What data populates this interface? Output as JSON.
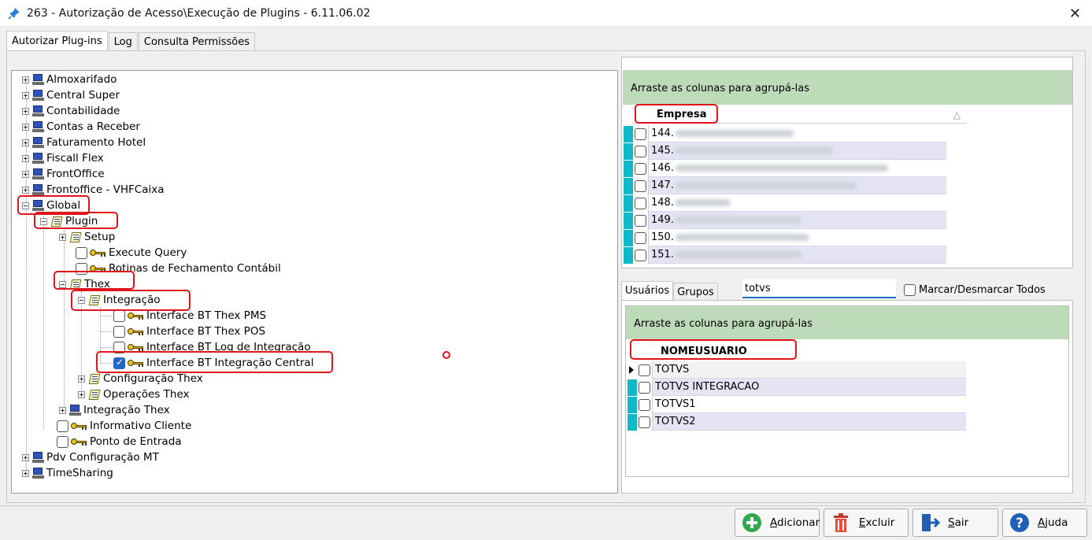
{
  "window": {
    "title": "263 - Autorização de Acesso\\Execução de Plugins - 6.11.06.02",
    "close_glyph": "✕"
  },
  "tabs": [
    {
      "label": "Autorizar Plug-ins",
      "active": true
    },
    {
      "label": "Log",
      "active": false
    },
    {
      "label": "Consulta Permissões",
      "active": false
    }
  ],
  "tree": {
    "almoxarifado": "Almoxarifado",
    "central_super": "Central Super",
    "contabilidade": "Contabilidade",
    "contas_receber": "Contas a Receber",
    "faturamento_hotel": "Faturamento Hotel",
    "fiscall_flex": "Fiscall Flex",
    "frontoffice": "FrontOffice",
    "frontoffice_vhf": "Frontoffice - VHFCaixa",
    "global": "Global",
    "plugin": "Plugin",
    "setup": "Setup",
    "execute_query": "Execute Query",
    "rotinas": "Rotinas de Fechamento Contábil",
    "thex": "Thex",
    "integracao": "Integração",
    "bt_pms": "Interface BT Thex PMS",
    "bt_pos": "Interface BT Thex POS",
    "bt_log": "Interface BT Log de Integração",
    "bt_central": "Interface BT Integração Central",
    "config_thex": "Configuração Thex",
    "operacoes_thex": "Operações Thex",
    "integracao_thex": "Integração Thex",
    "informativo": "Informativo Cliente",
    "ponto_entrada": "Ponto de Entrada",
    "pdv": "Pdv Configuração MT",
    "timesharing": "TimeSharing"
  },
  "empresa_grid": {
    "group_hint": "Arraste as colunas para agrupá-las",
    "column": "Empresa",
    "sort_glyph": "△",
    "rows": [
      "144.",
      "145.",
      "146.",
      "147.",
      "148.",
      "149.",
      "150.",
      "151."
    ]
  },
  "lower_tabs": [
    {
      "label": "Usuários",
      "active": true
    },
    {
      "label": "Grupos",
      "active": false
    }
  ],
  "search": {
    "value": "totvs"
  },
  "marcar_label": "Marcar/Desmarcar Todos",
  "usuario_grid": {
    "group_hint": "Arraste as colunas para agrupá-las",
    "column": "NOMEUSUARIO",
    "rows": [
      "TOTVS",
      "TOTVS INTEGRACAO",
      "TOTVS1",
      "TOTVS2"
    ]
  },
  "buttons": {
    "adicionar_u": "A",
    "adicionar_rest": "dicionar",
    "excluir_u": "E",
    "excluir_rest": "xcluir",
    "sair_u": "S",
    "sair_rest": "air",
    "ajuda_u": "A",
    "ajuda_rest": "juda"
  },
  "colors": {
    "accent_red": "#e0141c",
    "group_band": "#bedbb9",
    "teal": "#10b8c8"
  }
}
